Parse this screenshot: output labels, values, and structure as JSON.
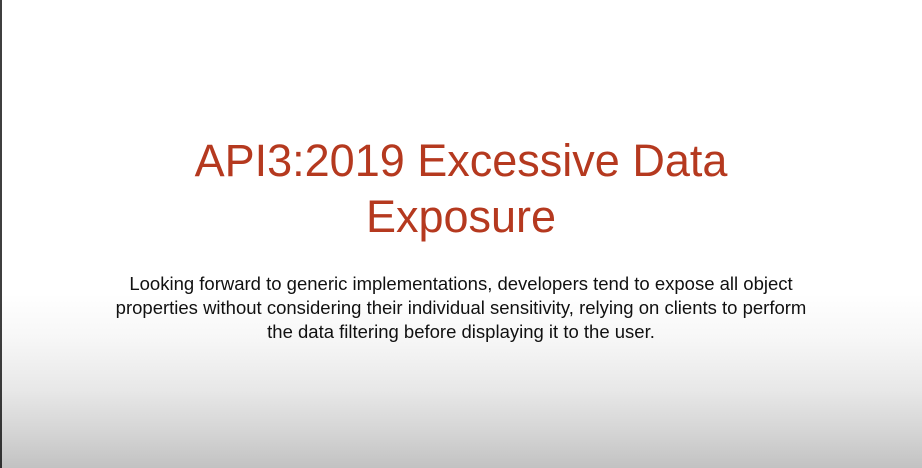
{
  "slide": {
    "title_line1": "API3:2019 Excessive Data",
    "title_line2": "Exposure",
    "body": "Looking forward to generic implementations, developers tend to expose all object properties without considering their individual sensitivity, relying on clients to perform the data filtering before displaying it to the user."
  },
  "colors": {
    "title": "#b5391f",
    "body_text": "#111111",
    "background": "#ffffff"
  }
}
